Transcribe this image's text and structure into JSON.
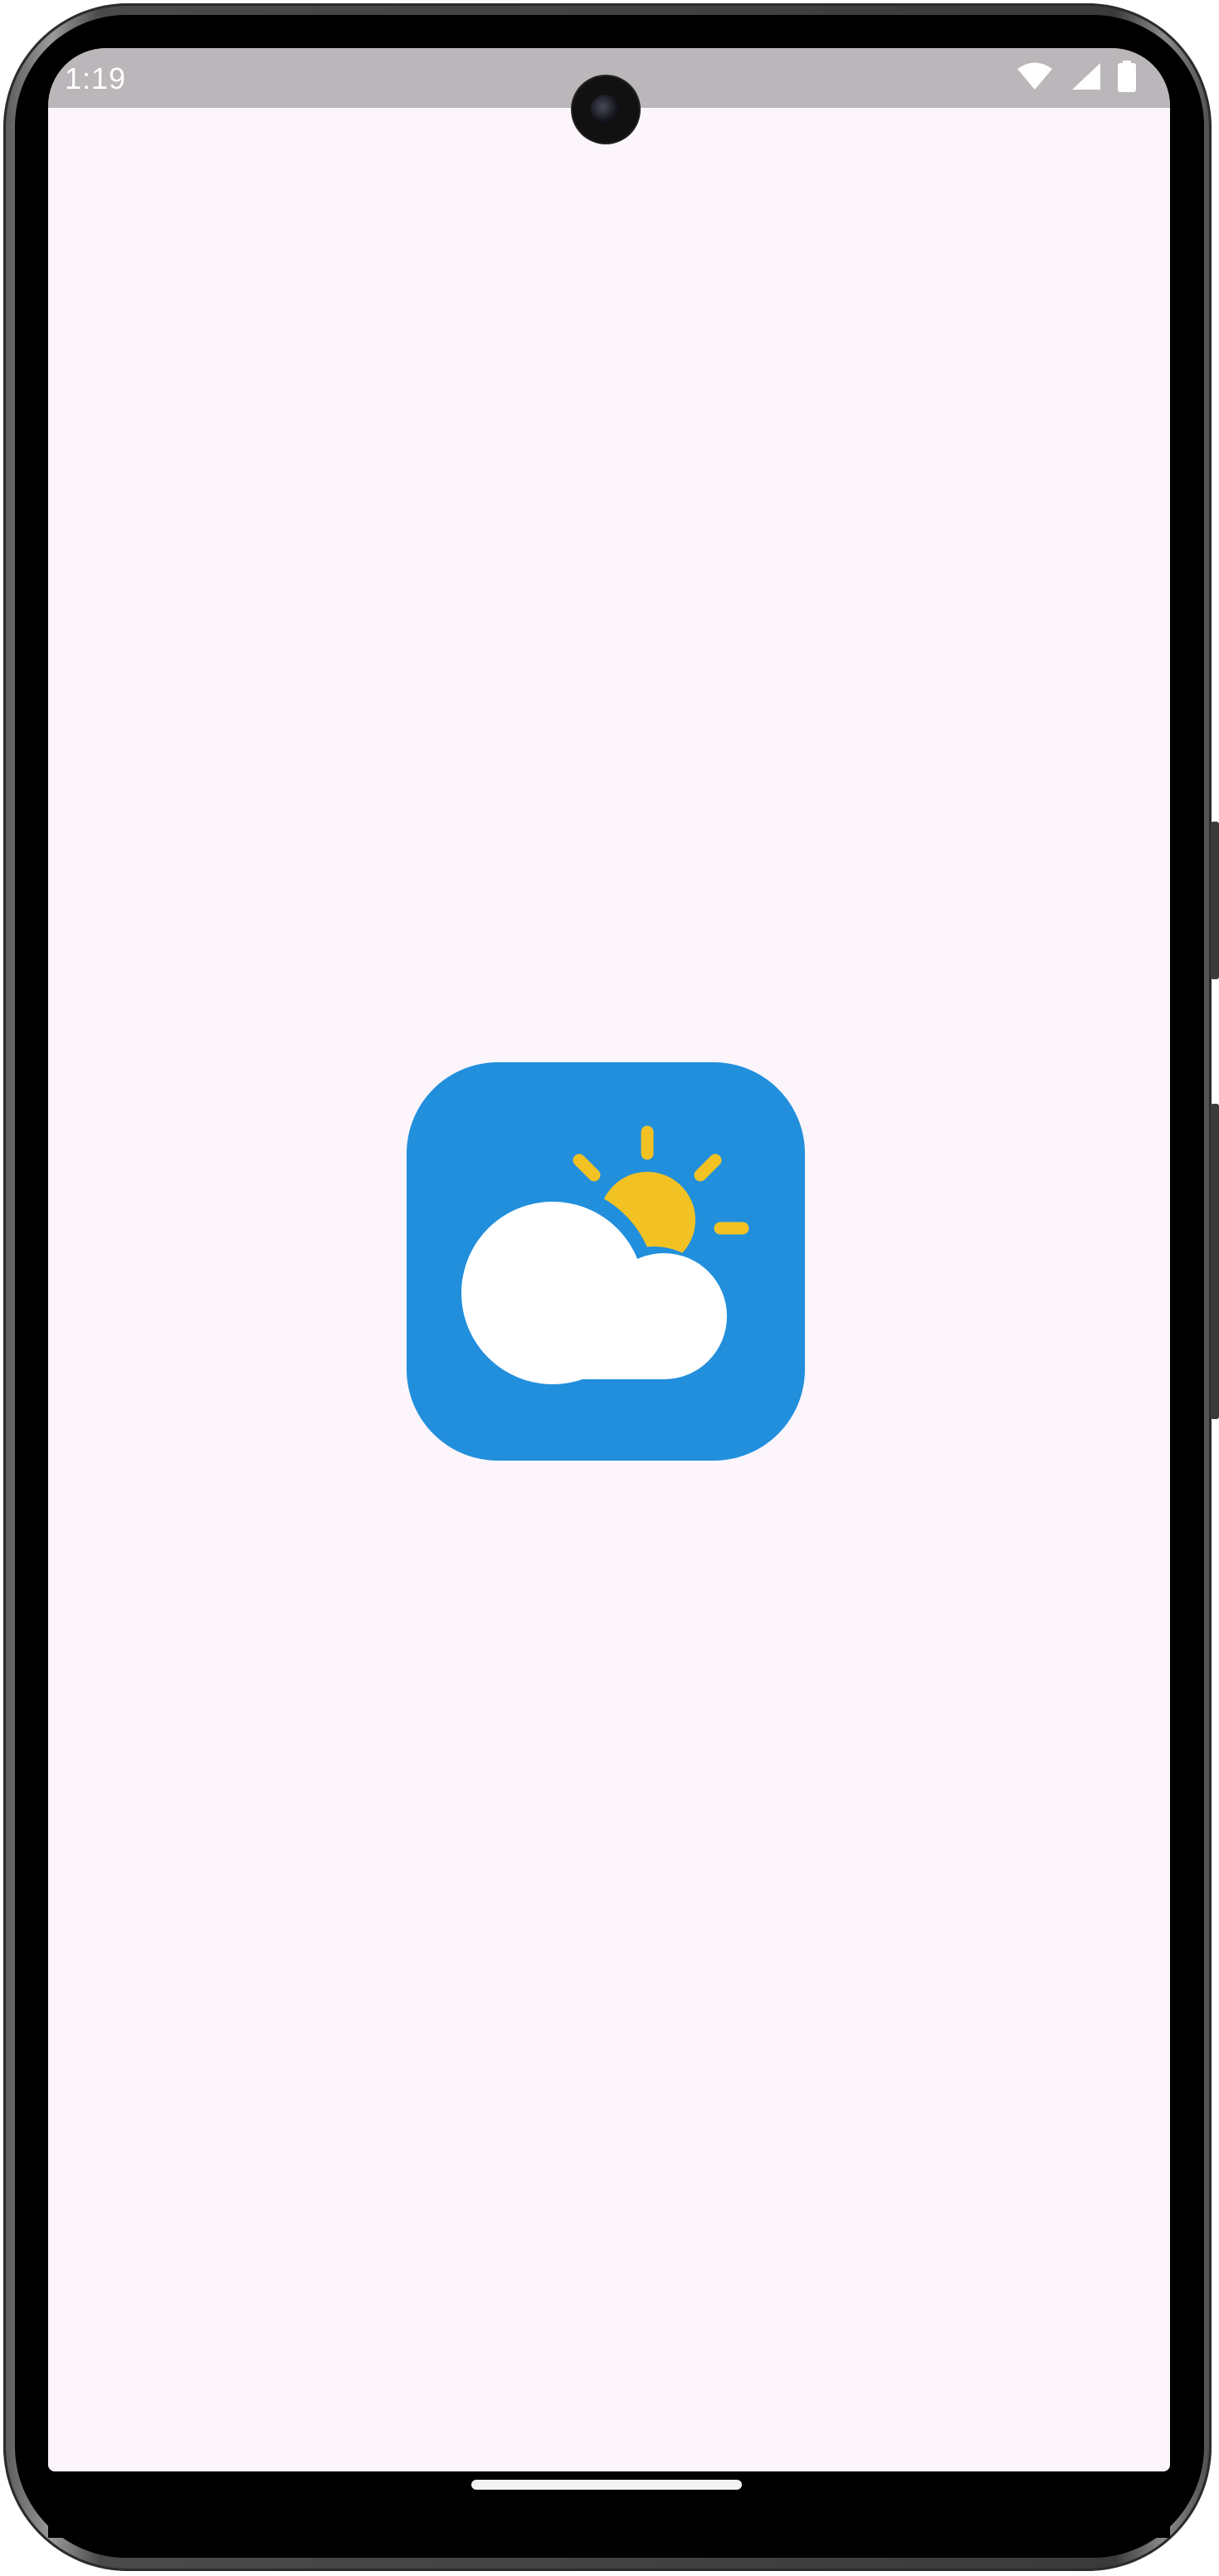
{
  "status_bar": {
    "time": "1:19",
    "wifi_icon": "wifi-icon",
    "signal_icon": "cellular-signal-icon",
    "battery_icon": "battery-icon"
  },
  "splash": {
    "app_icon": "weather-partly-cloudy-icon",
    "colors": {
      "background": "#fcf5fc",
      "icon_background": "#218fdc",
      "sun": "#f2c224",
      "cloud": "#ffffff",
      "status_bar": "#bab6ba"
    }
  },
  "navigation": {
    "gesture_handle": "gesture-navigation-handle"
  }
}
